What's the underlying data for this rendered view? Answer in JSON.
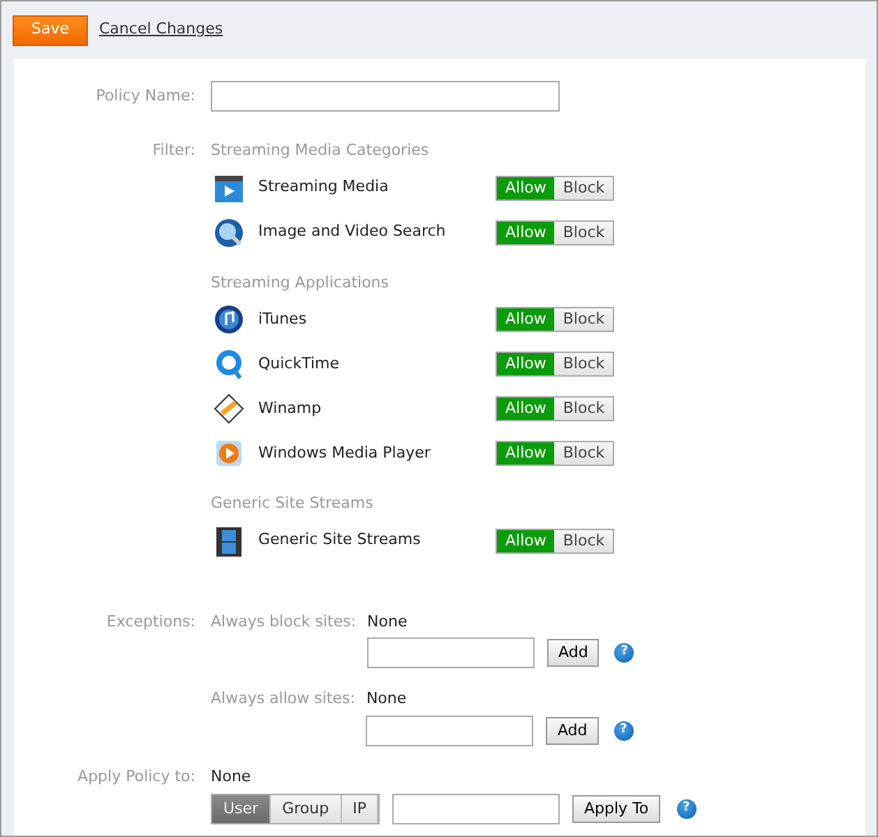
{
  "toolbar": {
    "save": "Save",
    "cancel": "Cancel Changes"
  },
  "policy_name": {
    "label": "Policy Name:"
  },
  "filter": {
    "label": "Filter:",
    "groups": [
      {
        "title": "Streaming Media Categories",
        "items": [
          {
            "name": "Streaming Media",
            "allow": "Allow",
            "block": "Block",
            "allowed": true
          },
          {
            "name": "Image and Video Search",
            "allow": "Allow",
            "block": "Block",
            "allowed": true
          }
        ]
      },
      {
        "title": "Streaming Applications",
        "items": [
          {
            "name": "iTunes",
            "allow": "Allow",
            "block": "Block",
            "allowed": true
          },
          {
            "name": "QuickTime",
            "allow": "Allow",
            "block": "Block",
            "allowed": true
          },
          {
            "name": "Winamp",
            "allow": "Allow",
            "block": "Block",
            "allowed": true
          },
          {
            "name": "Windows Media Player",
            "allow": "Allow",
            "block": "Block",
            "allowed": true
          }
        ]
      },
      {
        "title": "Generic Site Streams",
        "items": [
          {
            "name": "Generic Site Streams",
            "allow": "Allow",
            "block": "Block",
            "allowed": true
          }
        ]
      }
    ]
  },
  "exceptions": {
    "label": "Exceptions:",
    "rows": [
      {
        "label": "Always block sites:",
        "value": "None",
        "button": "Add",
        "help": "?"
      },
      {
        "label": "Always allow sites:",
        "value": "None",
        "button": "Add",
        "help": "?"
      }
    ]
  },
  "apply_policy": {
    "label": "Apply Policy to:",
    "value": "None",
    "targets": [
      {
        "label": "User",
        "selected": true
      },
      {
        "label": "Group",
        "selected": false
      },
      {
        "label": "IP",
        "selected": false
      }
    ],
    "button": "Apply To",
    "help": "?"
  }
}
